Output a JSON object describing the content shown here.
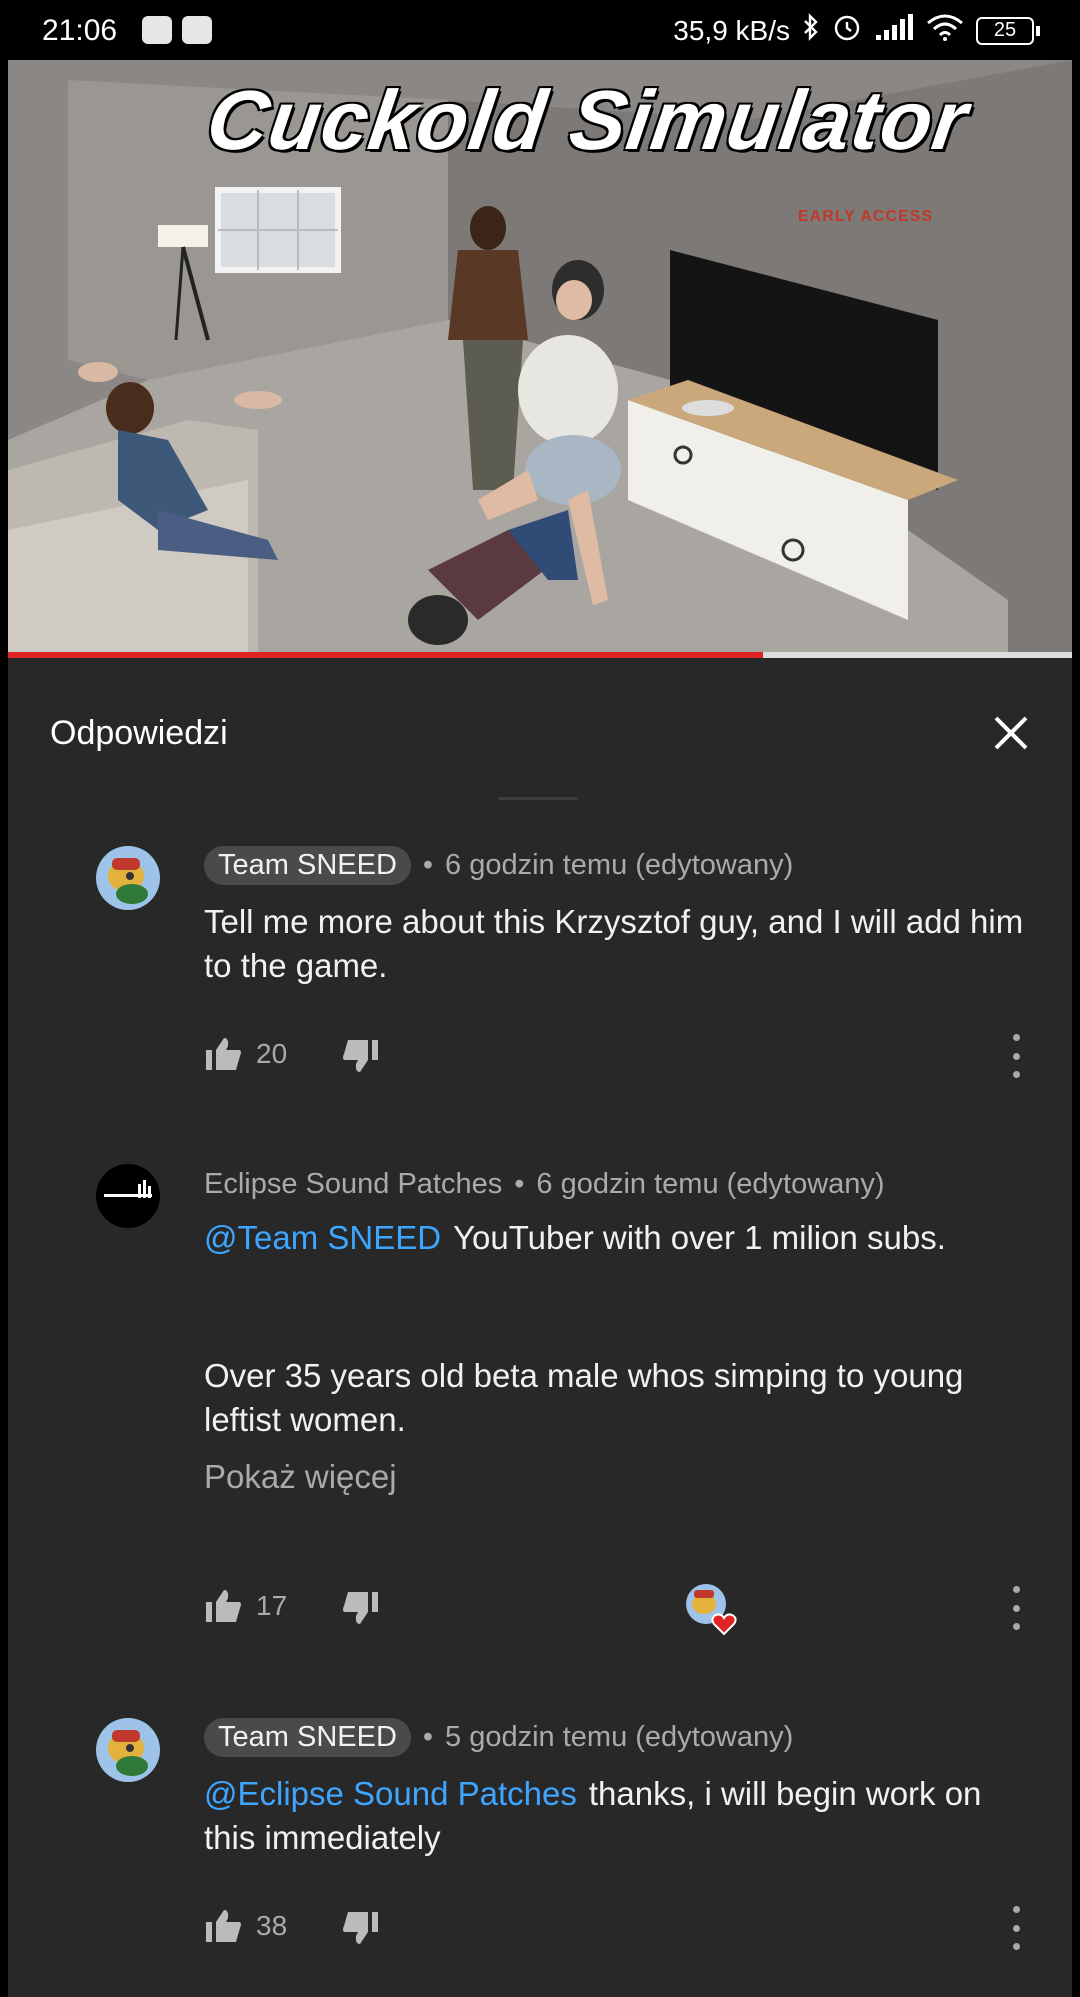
{
  "status_bar": {
    "time": "21:06",
    "net_speed": "35,9 kB/s",
    "battery": "25",
    "icons": [
      "app-notification-icon",
      "app-notification-icon",
      "bluetooth-icon",
      "alarm-icon",
      "signal-icon",
      "wifi-icon",
      "battery-icon"
    ]
  },
  "video": {
    "title": "Cuckold Simulator",
    "subtitle": "EARLY ACCESS",
    "progress": 0.71,
    "colors": {
      "progress_played": "#e02424",
      "progress_track": "#dddddd"
    }
  },
  "panel": {
    "title": "Odpowiedzi",
    "close_icon": "close-icon"
  },
  "comments": [
    {
      "author": "Team SNEED",
      "time": "6 godzin temu (edytowany)",
      "text": "Tell me more about this Krzysztof guy, and I will add him to the game.",
      "likes": "20"
    },
    {
      "author": "Eclipse Sound Patches",
      "time": "6 godzin temu (edytowany)",
      "mention": "@Team SNEED",
      "text_line1": "YouTuber with over 1 milion subs.",
      "text_line2": "Over 35 years old beta male whos simping to young leftist women.",
      "show_more": "Pokaż więcej",
      "likes": "17"
    },
    {
      "author": "Team SNEED",
      "time": "5 godzin temu (edytowany)",
      "mention": "@Eclipse Sound Patches",
      "text": "thanks, i will begin work on this immediately",
      "likes": "38"
    }
  ],
  "colors": {
    "panel_bg": "#282828",
    "mention": "#3ea6ff",
    "secondary_text": "#aaaaaa",
    "primary_text": "#f1f1f1"
  }
}
